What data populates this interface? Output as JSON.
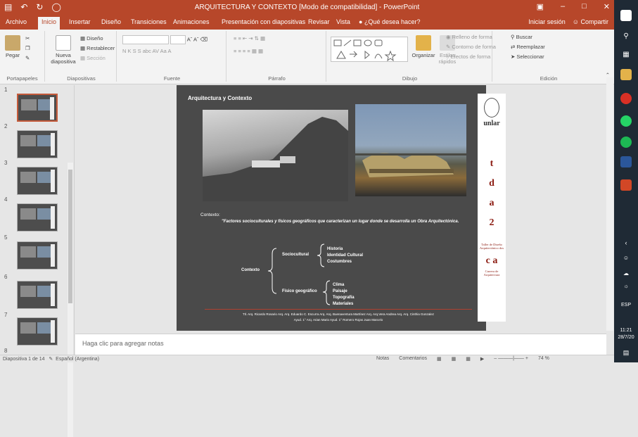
{
  "window": {
    "title": "ARQUITECTURA Y CONTEXTO [Modo de compatibilidad] - PowerPoint",
    "qat": [
      "save-icon",
      "undo-icon",
      "redo-icon",
      "start-icon"
    ],
    "controls": [
      "ribbon-options-icon",
      "minimize-icon",
      "maximize-icon",
      "close-icon"
    ]
  },
  "tabs": [
    "Archivo",
    "Inicio",
    "Insertar",
    "Diseño",
    "Transiciones",
    "Animaciones",
    "Presentación con diapositivas",
    "Revisar",
    "Vista"
  ],
  "tell_me": "¿Qué desea hacer?",
  "signin": "Iniciar sesión",
  "share": "Compartir",
  "ribbon": {
    "portapapeles": {
      "label": "Portapapeles",
      "pegar": "Pegar"
    },
    "diapositivas": {
      "label": "Diapositivas",
      "nueva": "Nueva",
      "nueva2": "diapositiva",
      "diseno": "Diseño",
      "restablecer": "Restablecer",
      "seccion": "Sección"
    },
    "fuente": {
      "label": "Fuente",
      "row2": "N K S S abc",
      "aa": "Aa"
    },
    "parrafo": {
      "label": "Párrafo"
    },
    "dibujo": {
      "label": "Dibujo",
      "organizar": "Organizar",
      "estilos": "Estilos",
      "estilos2": "rápidos",
      "relleno": "Relleno de forma",
      "contorno": "Contorno de forma",
      "efectos": "Efectos de forma"
    },
    "edicion": {
      "label": "Edición",
      "buscar": "Buscar",
      "reemplazar": "Reemplazar",
      "seleccionar": "Seleccionar"
    }
  },
  "thumbnails": [
    "1",
    "2",
    "3",
    "4",
    "5",
    "6",
    "7",
    "8"
  ],
  "slide": {
    "title": "Arquitectura y Contexto",
    "contexto_head": "Contexto:",
    "contexto_text": "\"Factores socioculturales y físicos geográficos que caracterizan un lugar donde se desarrolla un Obra Arquitectónica.",
    "diagram": {
      "root": "Contexto",
      "sociocultural": "Sociocultural",
      "socio_items": [
        "Historia",
        "Identidad Cultural",
        "Costumbres"
      ],
      "fisico": "Físico geográfico",
      "fisico_items": [
        "Clima",
        "Paisaje",
        "Topografía",
        "Materiales"
      ]
    },
    "footer_line1": "Ttl. Arq. Ricardo Rosario  Arq. Arq. Eduardo C. Escurra  Arq. Arq. Buenaventura Martínez Arq. Arq.Vera Andrea  Arq. Arq. Cinthia Gonzalez",
    "footer_line2": "Ayud. 1° Arq. Arian Mario  Ayud. 1° Romero Rojas Juan Marcelo",
    "brand": {
      "unlar": "unlar",
      "t": "t",
      "d": "d",
      "a": "a",
      "two": "2",
      "taller": "Taller de Diseño Arquitectónico dos",
      "ca": "c a",
      "carrera": "Carrera de Arquitectura"
    }
  },
  "notes": "Haga clic para agregar notas",
  "status": {
    "slide": "Diapositiva 1 de 14",
    "lang": "Español (Argentina)",
    "notas": "Notas",
    "comentarios": "Comentarios",
    "zoom": "74 %"
  },
  "taskbar": {
    "lang": "ESP",
    "time": "11:21",
    "date": "28/7/20"
  },
  "colors": {
    "accent": "#b7472a",
    "slide_bg": "#4a4a4a",
    "brand_red": "#8b1a10"
  }
}
